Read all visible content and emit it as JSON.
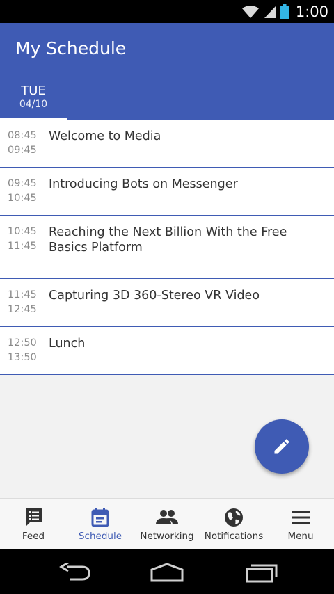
{
  "status_bar": {
    "time": "1:00"
  },
  "app_bar": {
    "title": "My Schedule",
    "day_tab": {
      "day": "TUE",
      "date": "04/10"
    }
  },
  "sessions": [
    {
      "start": "08:45",
      "end": "09:45",
      "title": "Welcome to Media"
    },
    {
      "start": "09:45",
      "end": "10:45",
      "title": "Introducing Bots on Messenger"
    },
    {
      "start": "10:45",
      "end": "11:45",
      "title": "Reaching the Next Billion With the Free Basics Platform"
    },
    {
      "start": "11:45",
      "end": "12:45",
      "title": "Capturing 3D 360-Stereo VR Video"
    },
    {
      "start": "12:50",
      "end": "13:50",
      "title": "Lunch"
    }
  ],
  "fab": {
    "icon": "pencil-icon"
  },
  "bottom_nav": [
    {
      "label": "Feed",
      "icon": "feed-icon"
    },
    {
      "label": "Schedule",
      "icon": "calendar-icon"
    },
    {
      "label": "Networking",
      "icon": "people-icon"
    },
    {
      "label": "Notifications",
      "icon": "globe-icon"
    },
    {
      "label": "Menu",
      "icon": "hamburger-icon"
    }
  ],
  "colors": {
    "primary": "#3f5bb4",
    "background": "#f2f2f2",
    "text": "#333333",
    "time_text": "#8a8a8a"
  }
}
